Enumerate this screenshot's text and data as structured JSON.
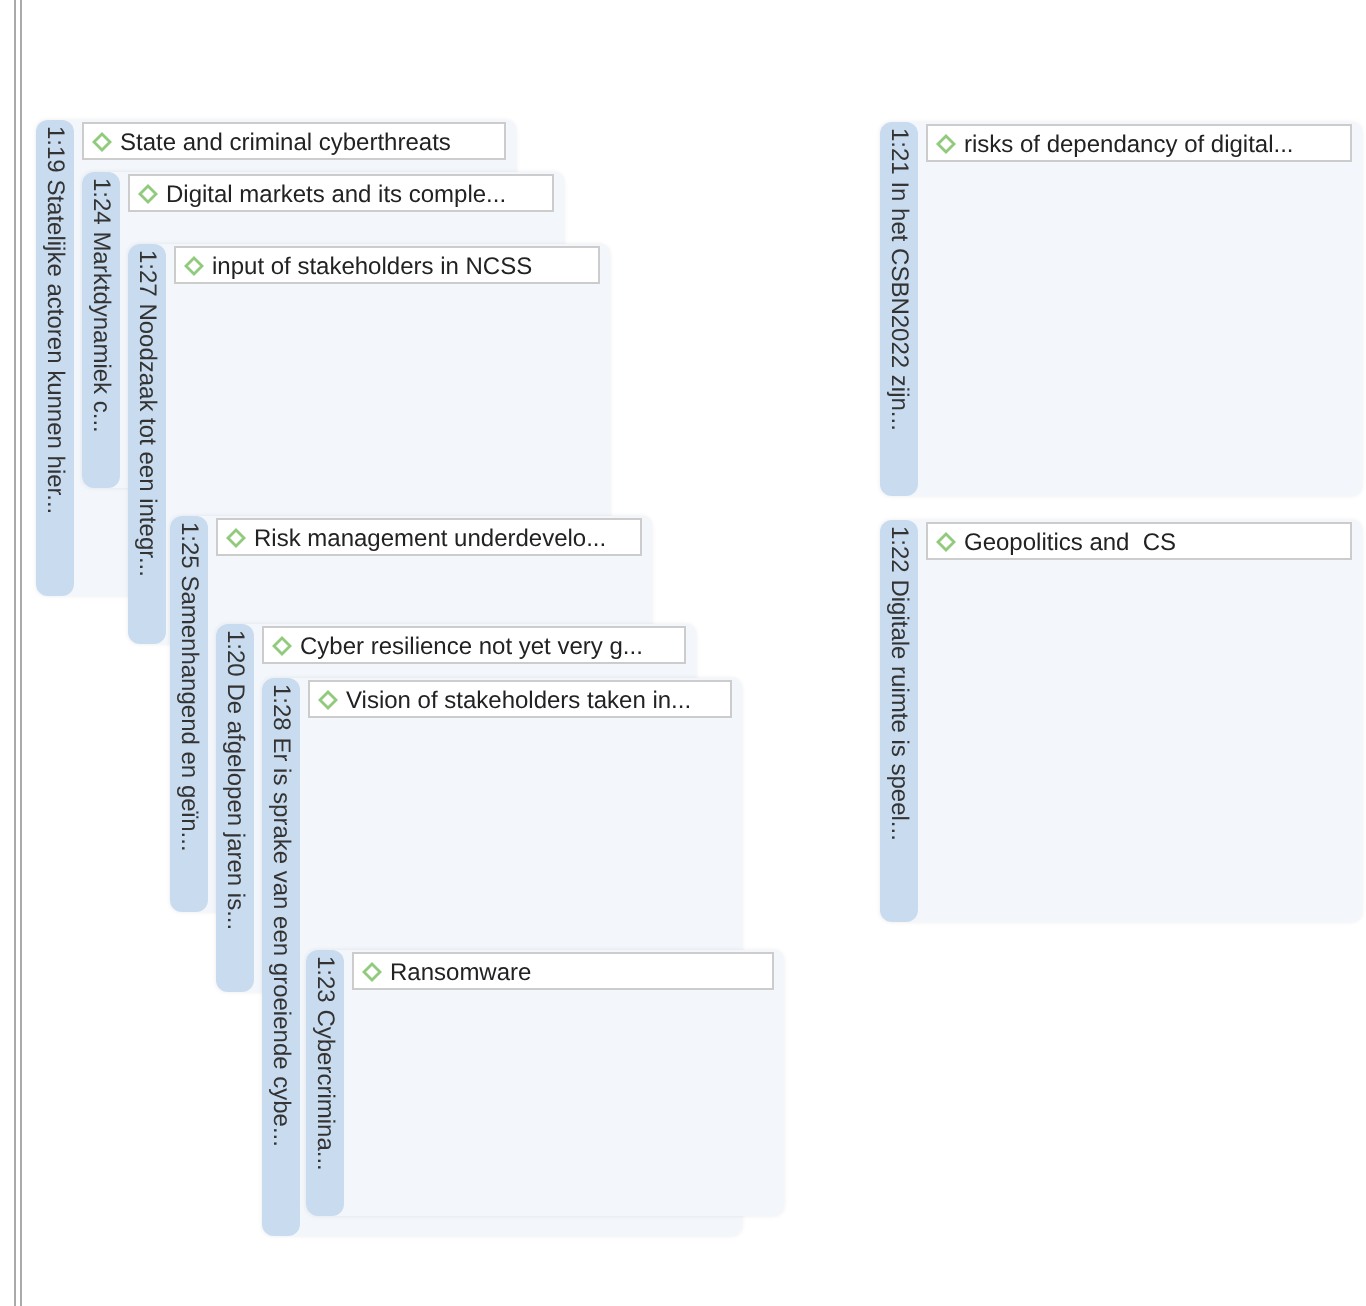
{
  "nodes": [
    {
      "quotation": "1:19 Statelijke actoren kunnen hier...",
      "code": "State and criminal cyberthreats"
    },
    {
      "quotation": "1:24 Marktdynamiek c...",
      "code": "Digital markets and its comple..."
    },
    {
      "quotation": "1:27 Noodzaak tot een integr...",
      "code": "input of stakeholders in NCSS"
    },
    {
      "quotation": "1:25 Samenhangend en geïn...",
      "code": "Risk management underdevelo..."
    },
    {
      "quotation": "1:20 De afgelopen jaren is...",
      "code": "Cyber resilience not yet very g..."
    },
    {
      "quotation": "1:28 Er is sprake van een groeiende  cybe...",
      "code": "Vision of stakeholders taken in..."
    },
    {
      "quotation": "1:23 Cybercrimina...",
      "code": "Ransomware"
    },
    {
      "quotation": "1:21 In het CSBN2022 zijn...",
      "code": "risks of dependancy of digital..."
    },
    {
      "quotation": "1:22 Digitale ruimte is speel...",
      "code": "Geopolitics and  CS"
    }
  ]
}
